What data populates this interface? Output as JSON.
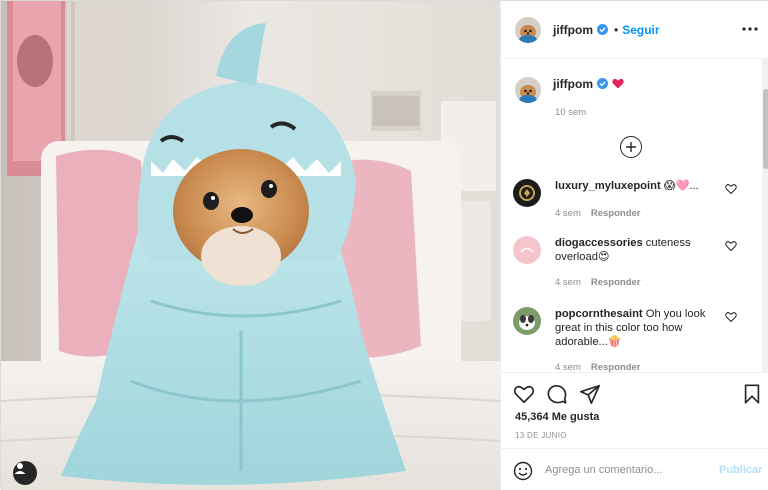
{
  "post": {
    "image_description_icon": "user-tag-icon",
    "owner": "jiffpom",
    "follow_label": "Seguir",
    "separator": "•",
    "caption_time": "10 sem"
  },
  "comments": [
    {
      "user": "luxury_myluxepoint",
      "text": "😱🩷...",
      "time": "4 sem",
      "reply": "Responder"
    },
    {
      "user": "diogaccessories",
      "text": "cuteness overload😍",
      "time": "4 sem",
      "reply": "Responder"
    },
    {
      "user": "popcornthesaint",
      "text": "Oh you look great in this color too how adorable...🍿",
      "time": "4 sem",
      "reply": "Responder"
    }
  ],
  "actions": {
    "likes": "45,364 Me gusta",
    "date": "13 DE JUNIO"
  },
  "composer": {
    "placeholder": "Agrega un comentario...",
    "publish_label": "Publicar"
  },
  "colors": {
    "accent": "#0095f6",
    "verified": "#3897f0",
    "muted": "#8e8e8e"
  }
}
